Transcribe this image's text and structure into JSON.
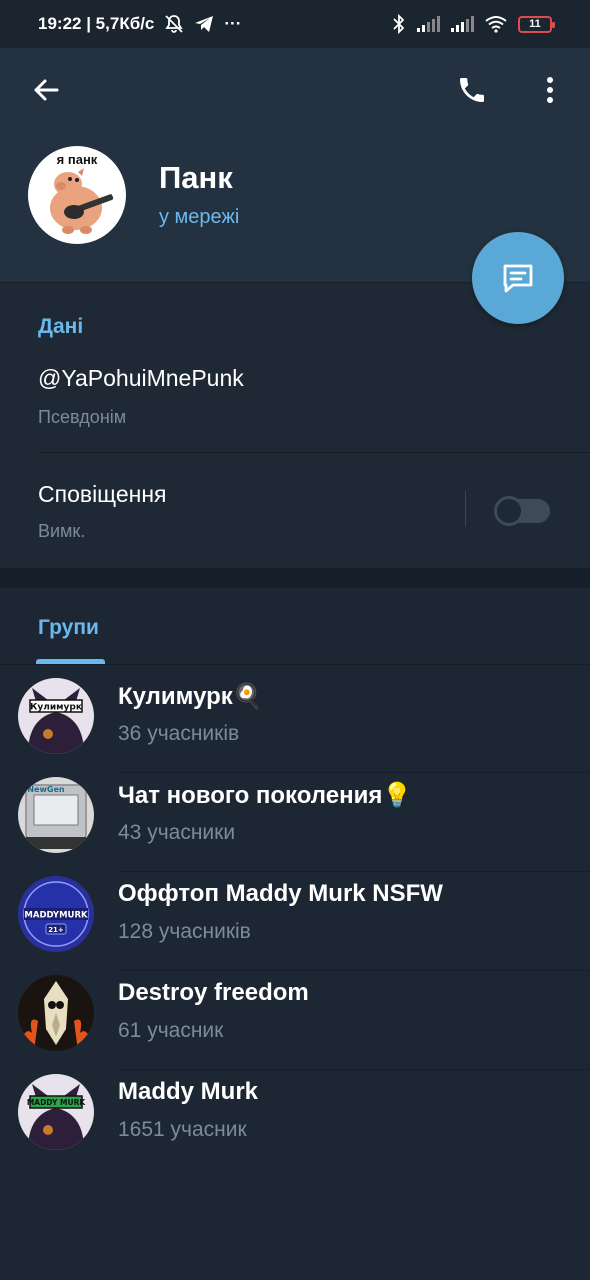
{
  "status_bar": {
    "time_speed": "19:22 | 5,7Кб/с",
    "more_dots": "···",
    "battery": "11",
    "icons": [
      "mute-bell-icon",
      "telegram-icon",
      "bluetooth-icon",
      "signal-icon",
      "signal-icon",
      "wifi-icon",
      "battery-icon"
    ]
  },
  "header": {
    "name": "Панк",
    "status": "у мережі",
    "avatar_caption": "я панк",
    "icons": [
      "back-arrow-icon",
      "phone-icon",
      "more-vertical-icon",
      "message-icon"
    ]
  },
  "info": {
    "title": "Дані",
    "username": "@YaPohuiMnePunk",
    "username_label": "Псевдонім",
    "notifications": "Сповіщення",
    "notifications_state": "Вимк.",
    "notifications_enabled": false
  },
  "groups": {
    "title": "Групи",
    "items": [
      {
        "name": "Кулимурк🍳",
        "members": "36 учасників",
        "avatar_text": "Кулимурк"
      },
      {
        "name": "Чат нового поколения💡",
        "members": "43 учасники",
        "avatar_text": "NewGen"
      },
      {
        "name": "Оффтоп Maddy Murk NSFW",
        "members": "128 учасників",
        "avatar_text": "MADDYMURK",
        "avatar_badge": "21+"
      },
      {
        "name": "Destroy freedom",
        "members": "61 учасник"
      },
      {
        "name": "Maddy Murk",
        "members": "1651 учасник",
        "avatar_text": "MADDY MURK"
      }
    ]
  },
  "colors": {
    "accent": "#6bb9ec",
    "fab": "#5aa8d6",
    "header_bg": "#233140",
    "page_bg": "#1d2733",
    "secondary_text": "#7d8b99"
  }
}
